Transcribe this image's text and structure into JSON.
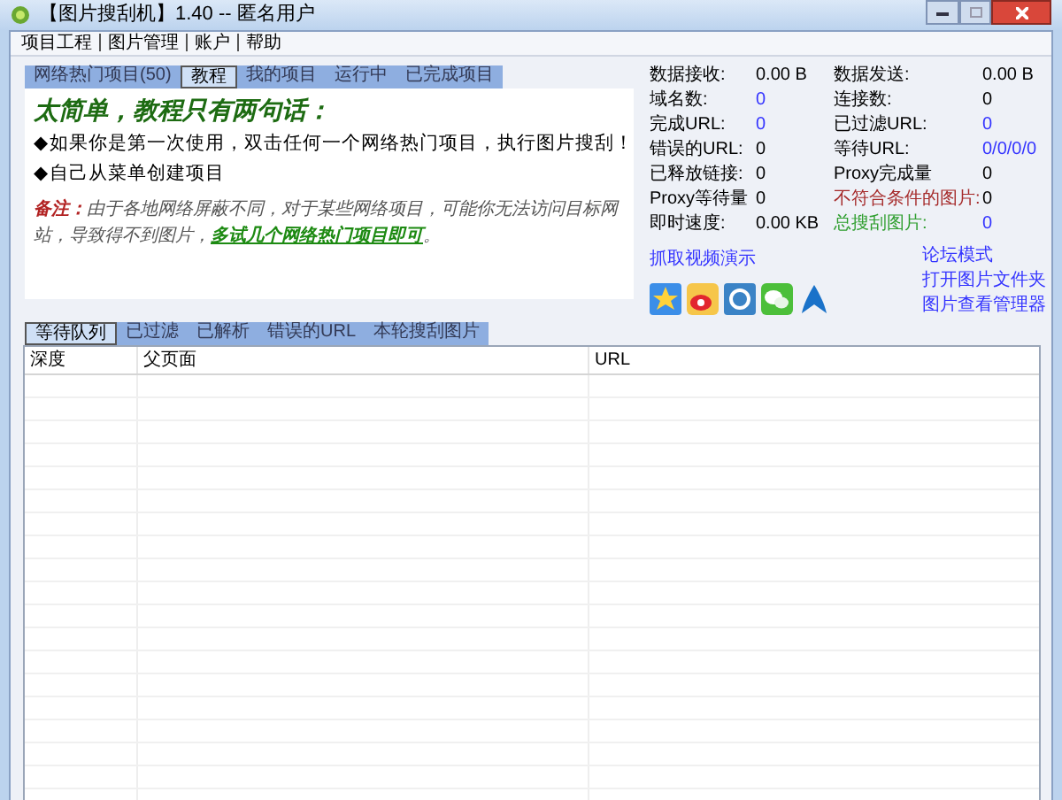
{
  "window": {
    "title": "【图片搜刮机】1.40 -- 匿名用户"
  },
  "menu": [
    "项目工程",
    "图片管理",
    "账户",
    "帮助"
  ],
  "top_tabs": [
    {
      "label": "网络热门项目(50)",
      "selected": false
    },
    {
      "label": "教程",
      "selected": true
    },
    {
      "label": "我的项目",
      "selected": false
    },
    {
      "label": "运行中",
      "selected": false
    },
    {
      "label": "已完成项目",
      "selected": false
    }
  ],
  "tutorial": {
    "heading": "太简单，教程只有两句话：",
    "bullets": [
      {
        "marker": "◆",
        "text": "如果你是第一次使用，双击任何一个网络热门项目，执行图片搜刮！"
      },
      {
        "marker": "◆",
        "text": "自己从菜单创建项目"
      }
    ],
    "note": {
      "label": "备注：",
      "text": "由于各地网络屏蔽不同，对于某些网络项目，可能你无法访问目标网站，导致得不到图片，",
      "link": "多试几个网络热门项目即可",
      "end": "。"
    }
  },
  "stats": [
    {
      "label": "数据接收:",
      "value": "0.00 B",
      "kind": "plain"
    },
    {
      "label": "数据发送:",
      "value": "0.00 B",
      "kind": "plain"
    },
    {
      "label": "域名数:",
      "value": "0",
      "kind": "count"
    },
    {
      "label": "连接数:",
      "value": "0",
      "kind": "plain"
    },
    {
      "label": "完成URL:",
      "value": "0",
      "kind": "count"
    },
    {
      "label": "已过滤URL:",
      "value": "0",
      "kind": "count"
    },
    {
      "label": "错误的URL:",
      "value": "0",
      "kind": "plain"
    },
    {
      "label": "等待URL:",
      "value": "0/0/0/0",
      "kind": "count"
    },
    {
      "label": "已释放链接:",
      "value": "0",
      "kind": "plain"
    },
    {
      "label": "Proxy完成量",
      "value": "0",
      "kind": "plain"
    },
    {
      "label": "Proxy等待量",
      "value": "0",
      "kind": "plain"
    },
    {
      "label": "不符合条件的图片:",
      "value": "0",
      "kind": "alert"
    },
    {
      "label": "即时速度:",
      "value": "0.00 KB",
      "kind": "plain"
    },
    {
      "label": "总搜刮图片:",
      "value": "0",
      "kind": "total"
    }
  ],
  "video_link": "抓取视频演示",
  "side_links": [
    "论坛模式",
    "打开图片文件夹",
    "图片查看管理器"
  ],
  "bottom_tabs": [
    {
      "label": "等待队列",
      "selected": true
    },
    {
      "label": "已过滤",
      "selected": false
    },
    {
      "label": "已解析",
      "selected": false
    },
    {
      "label": "错误的URL",
      "selected": false
    },
    {
      "label": "本轮搜刮图片",
      "selected": false
    }
  ],
  "table": {
    "columns": [
      "深度",
      "父页面",
      "URL"
    ]
  }
}
